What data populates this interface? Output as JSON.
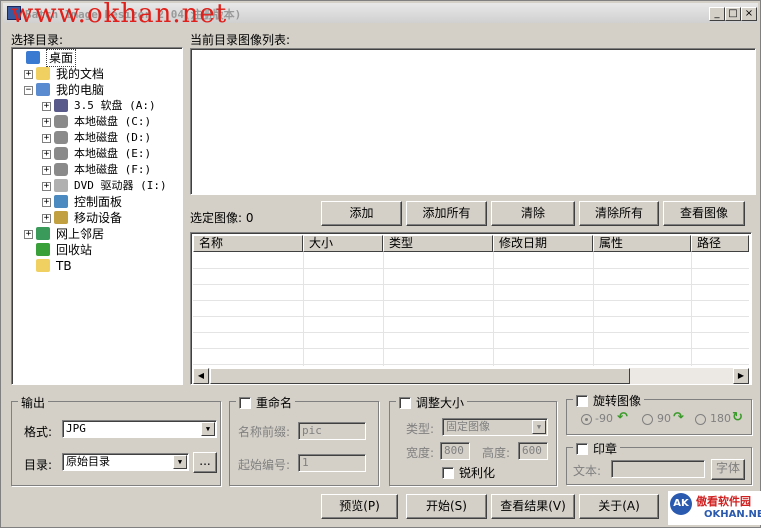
{
  "window": {
    "title": "Batch Image Resizer 2.04(注册版本)",
    "watermark": "www.okhan.net"
  },
  "left": {
    "label": "选择目录:",
    "tree": [
      {
        "label": "桌面",
        "icon": "desktop-icon",
        "exp": ""
      },
      {
        "label": "我的文档",
        "icon": "folder-docs-icon",
        "exp": "+"
      },
      {
        "label": "我的电脑",
        "icon": "computer-icon",
        "exp": "−"
      },
      {
        "label": "3.5 软盘 (A:)",
        "icon": "floppy-icon",
        "exp": "+"
      },
      {
        "label": "本地磁盘 (C:)",
        "icon": "drive-icon",
        "exp": "+"
      },
      {
        "label": "本地磁盘 (D:)",
        "icon": "drive-icon",
        "exp": "+"
      },
      {
        "label": "本地磁盘 (E:)",
        "icon": "drive-icon",
        "exp": "+"
      },
      {
        "label": "本地磁盘 (F:)",
        "icon": "drive-icon",
        "exp": "+"
      },
      {
        "label": "DVD 驱动器 (I:)",
        "icon": "dvd-icon",
        "exp": "+"
      },
      {
        "label": "控制面板",
        "icon": "control-panel-icon",
        "exp": "+"
      },
      {
        "label": "移动设备",
        "icon": "mobile-device-icon",
        "exp": "+"
      },
      {
        "label": "网上邻居",
        "icon": "network-icon",
        "exp": "+"
      },
      {
        "label": "回收站",
        "icon": "recycle-bin-icon",
        "exp": ""
      },
      {
        "label": "TB",
        "icon": "folder-icon",
        "exp": ""
      }
    ]
  },
  "right": {
    "list_label": "当前目录图像列表:",
    "selected_label": "选定图像: 0",
    "buttons": [
      "添加",
      "添加所有",
      "清除",
      "清除所有",
      "查看图像"
    ],
    "columns": [
      "名称",
      "大小",
      "类型",
      "修改日期",
      "属性",
      "路径"
    ]
  },
  "output": {
    "title": "输出",
    "format_label": "格式:",
    "format_value": "JPG",
    "dir_label": "目录:",
    "dir_value": "原始目录",
    "browse": "..."
  },
  "rename": {
    "title": "重命名",
    "prefix_label": "名称前缀:",
    "prefix_value": "pic",
    "start_label": "起始编号:",
    "start_value": "1"
  },
  "resize": {
    "title": "调整大小",
    "type_label": "类型:",
    "type_value": "固定图像",
    "width_label": "宽度:",
    "width_value": "800",
    "height_label": "高度:",
    "height_value": "600",
    "sharpen": "锐利化"
  },
  "rotate": {
    "title": "旋转图像",
    "options": [
      "-90",
      "90",
      "180"
    ]
  },
  "stamp": {
    "title": "印章",
    "text_label": "文本:",
    "font_button": "字体"
  },
  "bottom": {
    "preview": "预览(P)",
    "start": "开始(S)",
    "view_result": "查看结果(V)",
    "about": "关于(A)"
  },
  "logo": {
    "brand": "傲看软件园",
    "url": "OKHAN.NET",
    "mark": "AK"
  }
}
